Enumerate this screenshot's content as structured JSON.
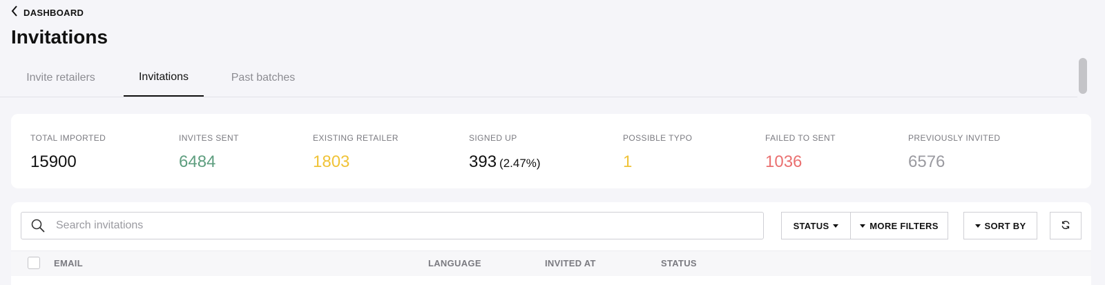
{
  "nav": {
    "back_label": "DASHBOARD"
  },
  "page": {
    "title": "Invitations"
  },
  "tabs": [
    {
      "label": "Invite retailers",
      "active": false
    },
    {
      "label": "Invitations",
      "active": true
    },
    {
      "label": "Past batches",
      "active": false
    }
  ],
  "stats": [
    {
      "label": "TOTAL IMPORTED",
      "value": "15900",
      "color": "#111111"
    },
    {
      "label": "INVITES SENT",
      "value": "6484",
      "color": "#5e9e7f"
    },
    {
      "label": "EXISTING RETAILER",
      "value": "1803",
      "color": "#f0c337"
    },
    {
      "label": "SIGNED UP",
      "value": "393",
      "extra": "(2.47%)",
      "color": "#111111"
    },
    {
      "label": "POSSIBLE TYPO",
      "value": "1",
      "color": "#f0c337"
    },
    {
      "label": "FAILED TO SENT",
      "value": "1036",
      "color": "#ea7070"
    },
    {
      "label": "PREVIOUSLY INVITED",
      "value": "6576",
      "color": "#9a9aa0"
    }
  ],
  "search": {
    "placeholder": "Search invitations",
    "value": ""
  },
  "filters": {
    "status_label": "STATUS",
    "more_filters_label": "MORE FILTERS",
    "sort_by_label": "SORT BY"
  },
  "table": {
    "columns": [
      "EMAIL",
      "LANGUAGE",
      "INVITED AT",
      "STATUS"
    ]
  },
  "icons": {
    "back": "chevron-left-icon",
    "search": "search-icon",
    "refresh": "refresh-icon",
    "dropdown": "caret-down-icon"
  }
}
